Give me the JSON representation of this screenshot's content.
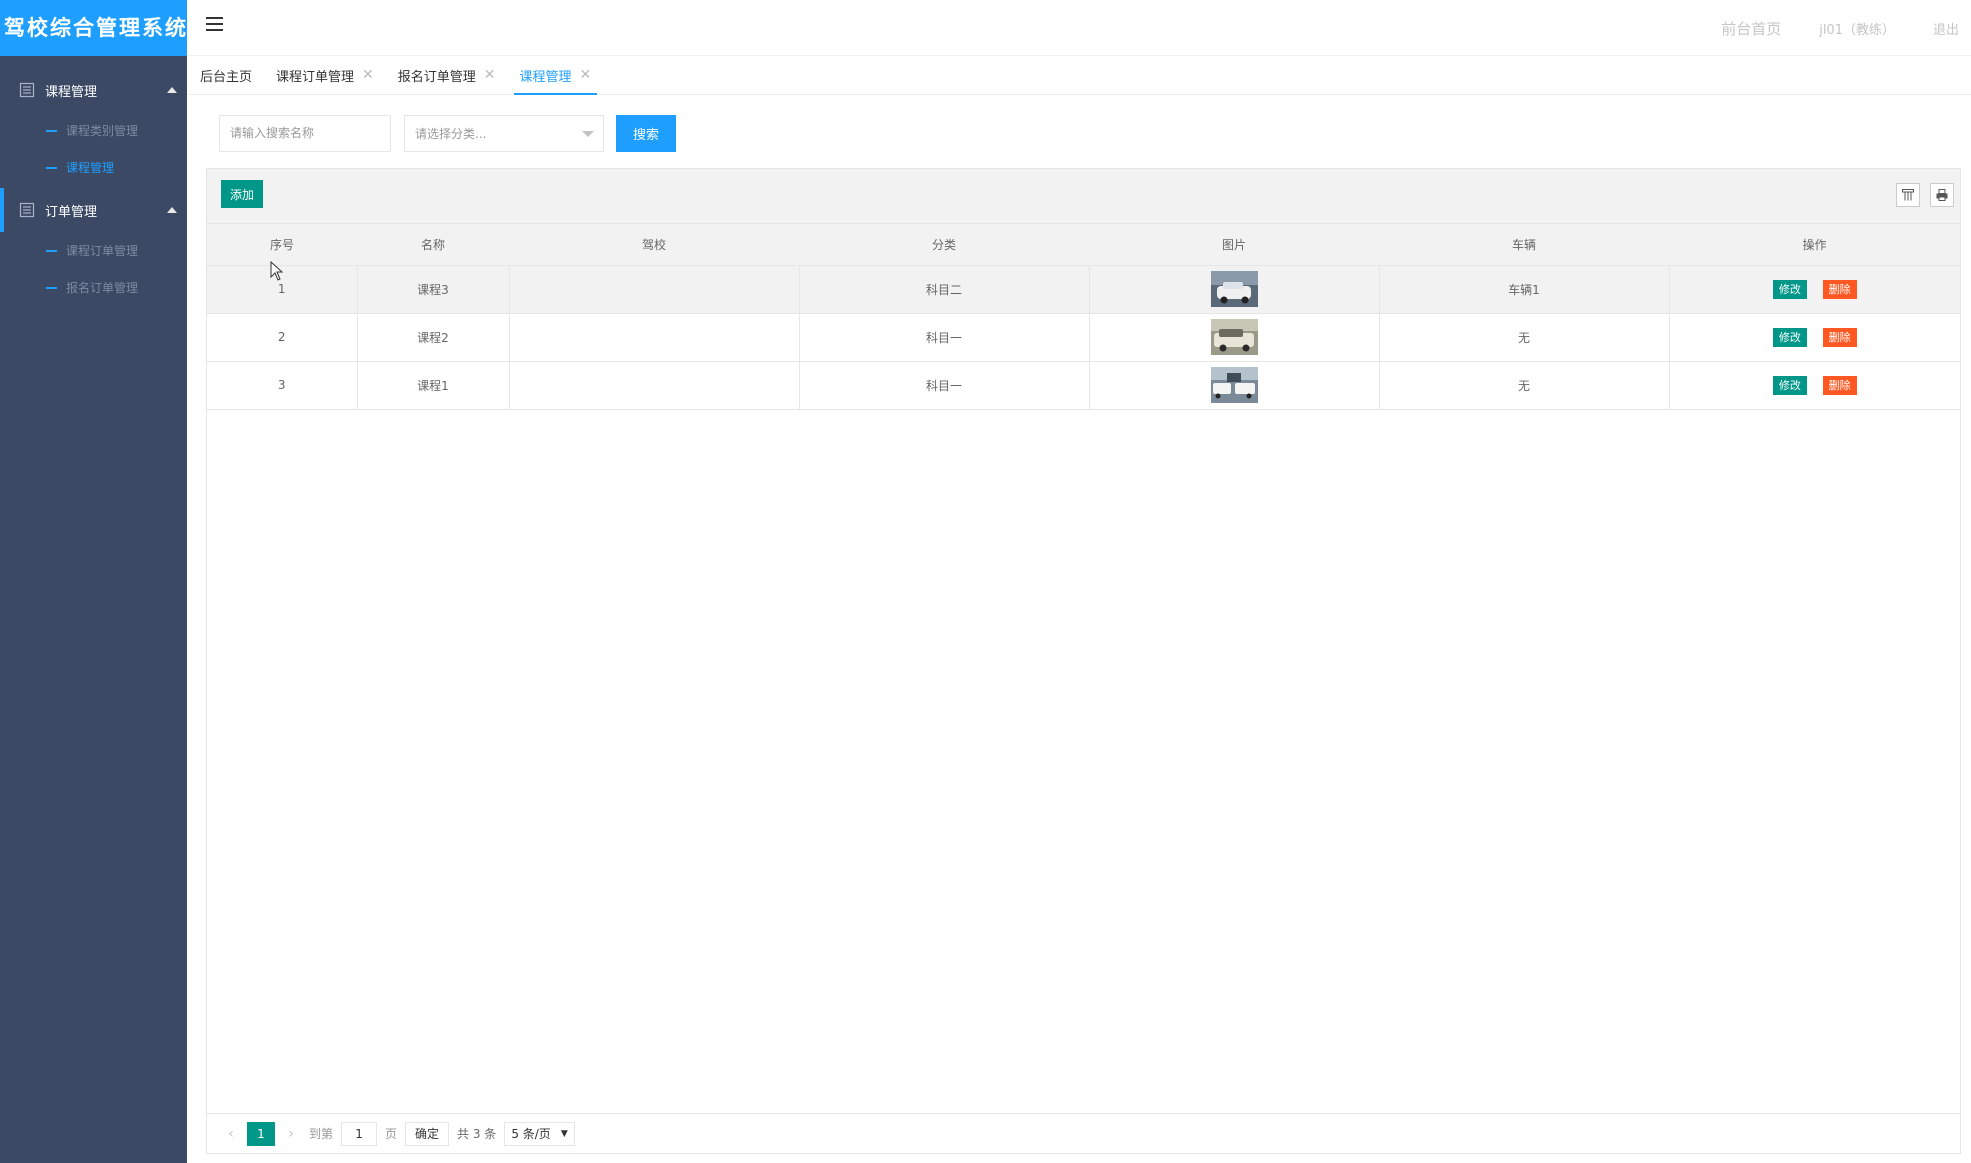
{
  "app": {
    "title": "驾校综合管理系统"
  },
  "sidebar": {
    "groups": [
      {
        "label": "课程管理",
        "items": [
          "课程类别管理",
          "课程管理"
        ]
      },
      {
        "label": "订单管理",
        "items": [
          "课程订单管理",
          "报名订单管理"
        ]
      }
    ]
  },
  "header": {
    "front_link": "前台首页",
    "user": "jl01（教练）",
    "logout": "退出"
  },
  "tabs": [
    {
      "label": "后台主页"
    },
    {
      "label": "课程订单管理"
    },
    {
      "label": "报名订单管理"
    },
    {
      "label": "课程管理"
    }
  ],
  "search": {
    "placeholder": "请输入搜索名称",
    "select_placeholder": "请选择分类...",
    "button": "搜索"
  },
  "toolbar": {
    "add": "添加"
  },
  "table": {
    "columns": [
      "序号",
      "名称",
      "驾校",
      "分类",
      "图片",
      "车辆",
      "操作"
    ],
    "rows": [
      {
        "no": "1",
        "name": "课程3",
        "school": "",
        "category": "科目二",
        "vehicle": "车辆1"
      },
      {
        "no": "2",
        "name": "课程2",
        "school": "",
        "category": "科目一",
        "vehicle": "无"
      },
      {
        "no": "3",
        "name": "课程1",
        "school": "",
        "category": "科目一",
        "vehicle": "无"
      }
    ],
    "edit_label": "修改",
    "delete_label": "删除"
  },
  "pager": {
    "current": "1",
    "goto_prefix": "到第",
    "goto_value": "1",
    "goto_suffix": "页",
    "confirm": "确定",
    "total": "共 3 条",
    "page_size": "5 条/页"
  },
  "colors": {
    "primary": "#1e9fff",
    "teal": "#009688",
    "danger": "#ff5722",
    "sidebar": "#3b4964"
  }
}
